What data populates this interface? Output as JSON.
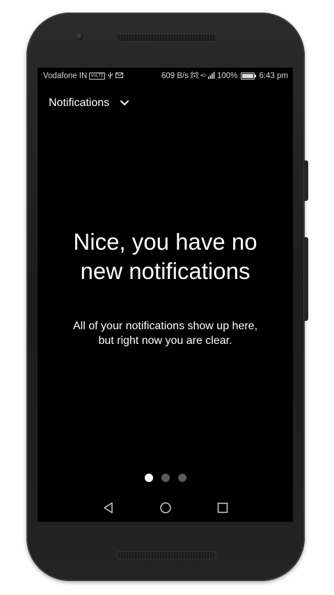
{
  "status_bar": {
    "carrier": "Vodafone IN",
    "volte_badge": "VoLTE",
    "network_speed": "609 B/s",
    "network_type": "4G",
    "battery_percent": "100%",
    "battery_level": 1.0,
    "time": "6:43 pm",
    "icons": [
      "volte-icon",
      "usb-icon",
      "gmail-icon",
      "hotspot-icon",
      "signal-icon",
      "battery-icon"
    ]
  },
  "header": {
    "title": "Notifications",
    "dropdown_icon": "chevron-down-icon"
  },
  "empty_state": {
    "headline_line1": "Nice, you have no",
    "headline_line2": "new notifications",
    "body_line1": "All of your notifications show up here,",
    "body_line2": "but right now you are clear."
  },
  "pager": {
    "page_count": 3,
    "active_index": 0
  },
  "nav_bar": {
    "icons": [
      "back-icon",
      "home-icon",
      "recents-icon"
    ]
  },
  "colors": {
    "screen_background": "#000000",
    "text": "#ffffff",
    "dot_active": "#ffffff",
    "dot_inactive": "#5a5a5a"
  }
}
